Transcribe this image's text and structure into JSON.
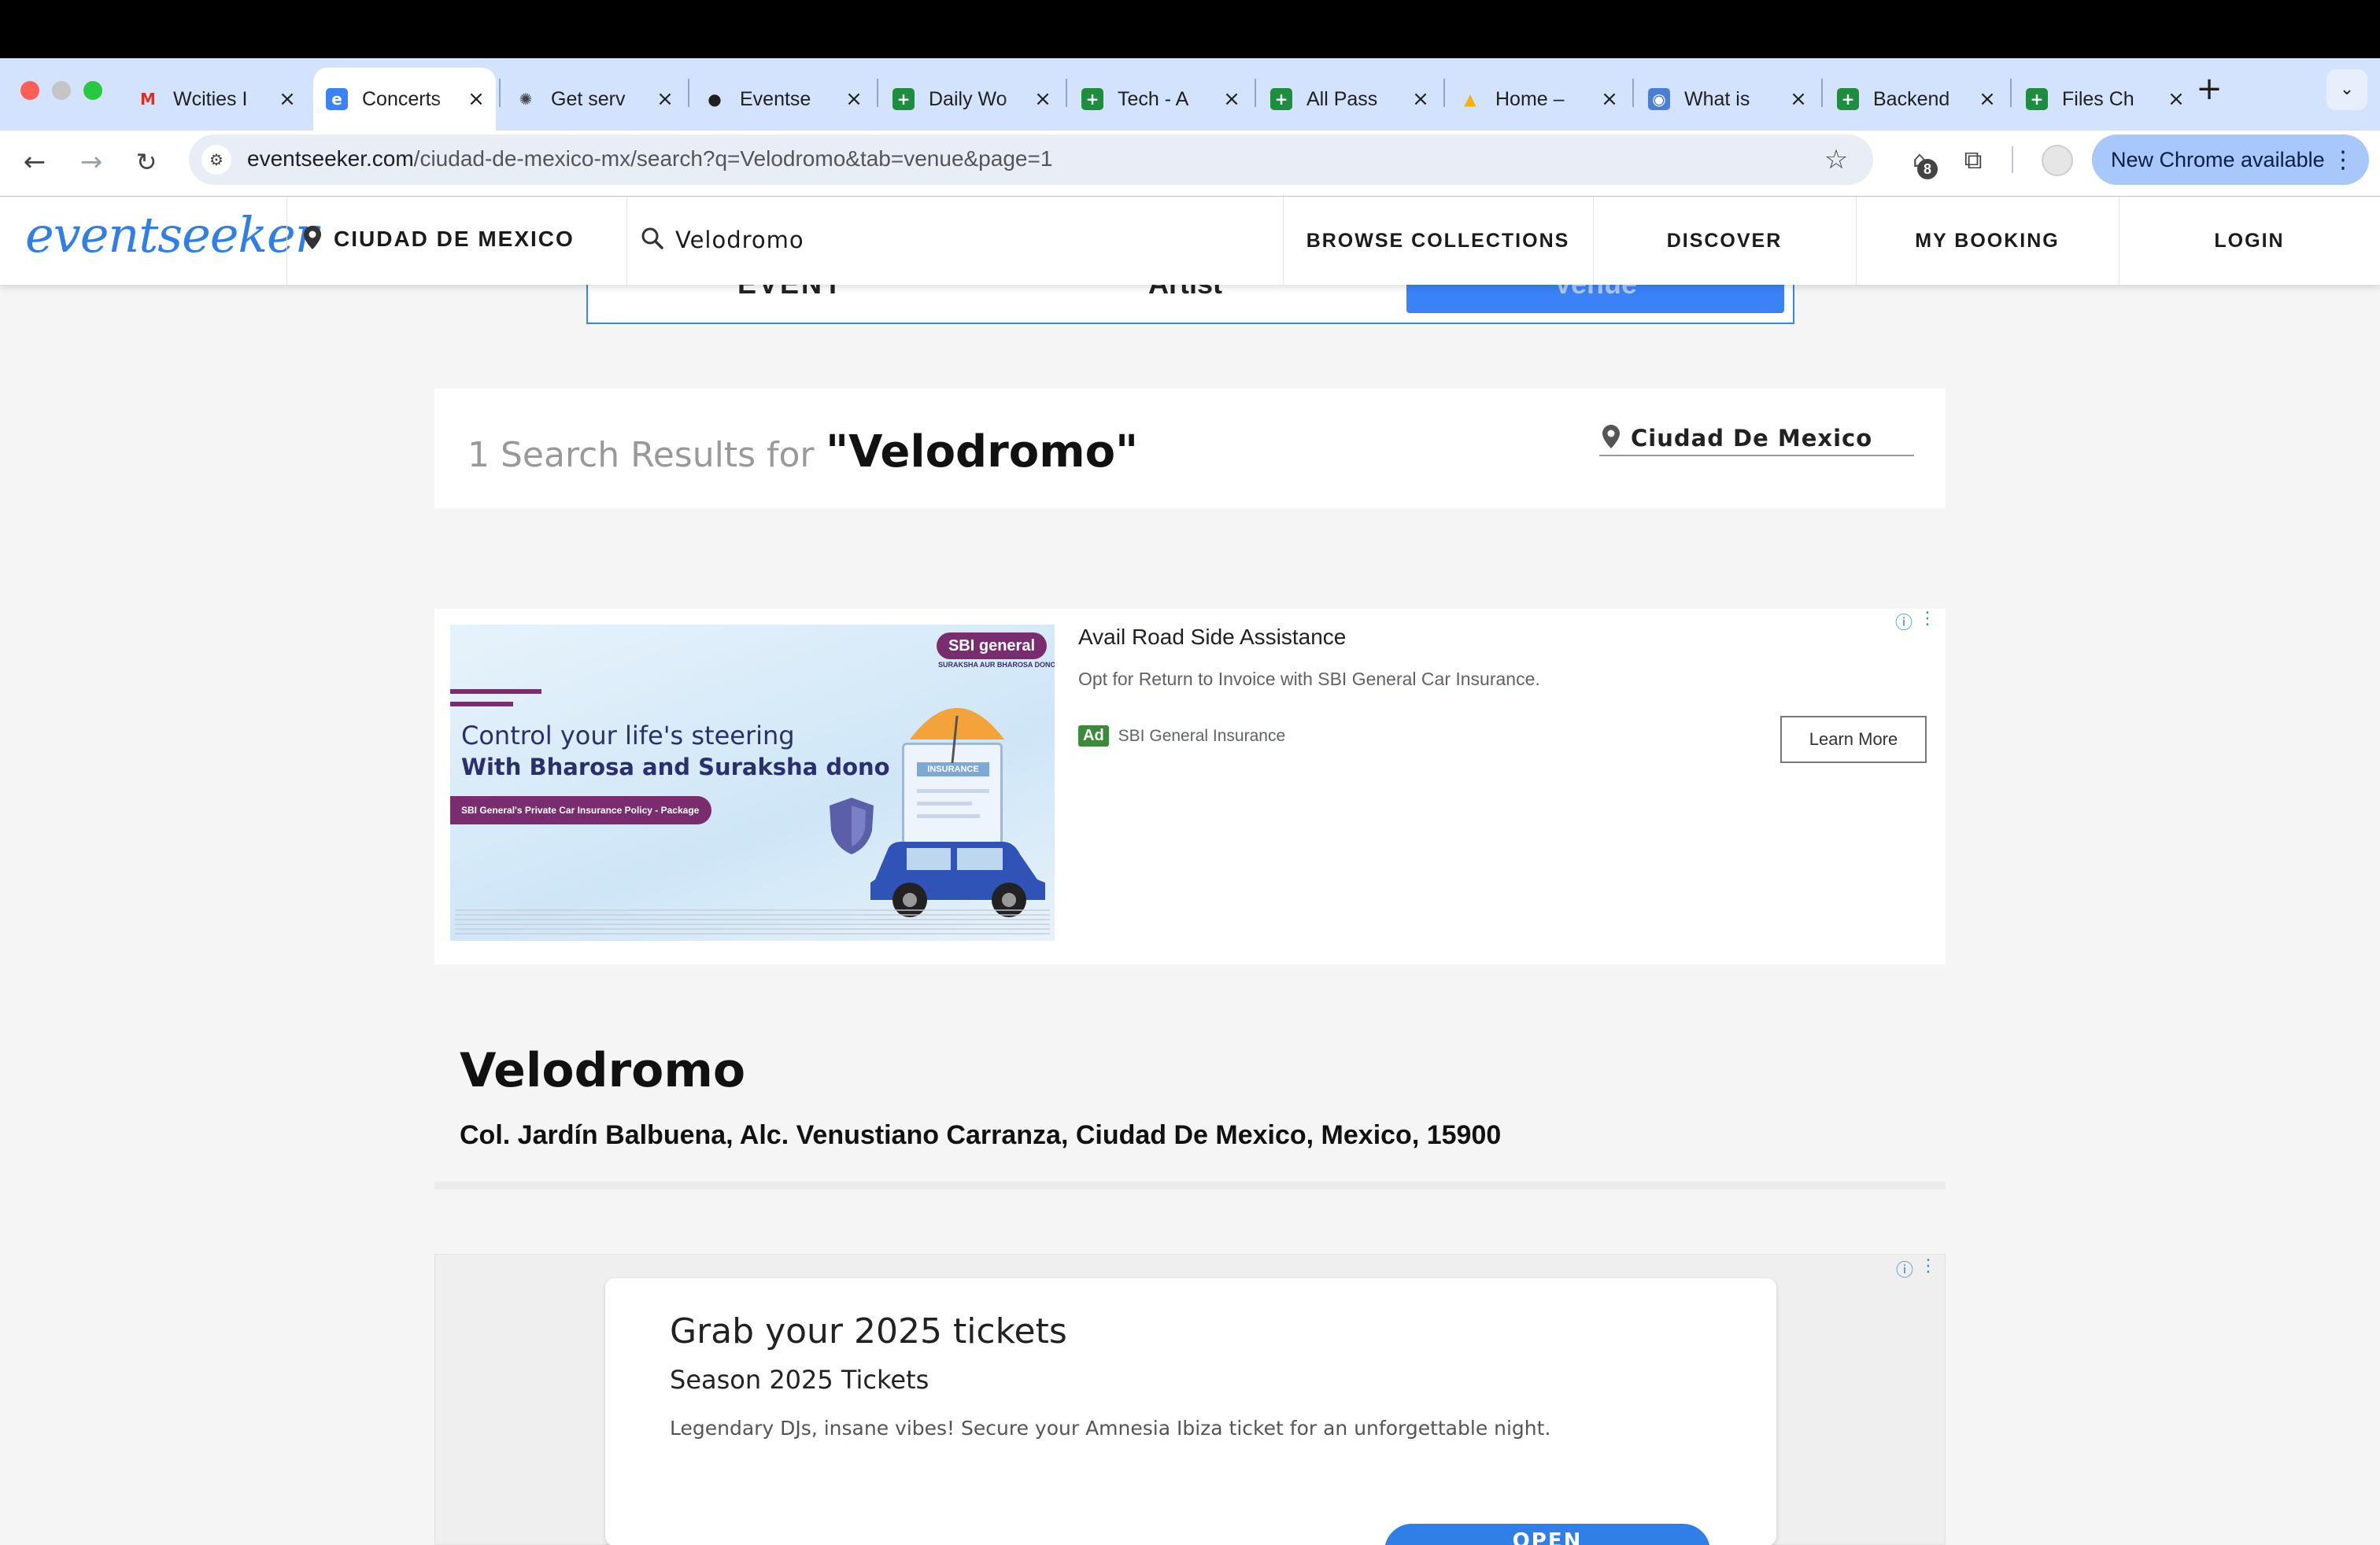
{
  "browser": {
    "tabs": [
      {
        "title": "Wcities I",
        "icon": "gmail-icon"
      },
      {
        "title": "Concerts",
        "icon": "eventseeker-icon"
      },
      {
        "title": "Get serv",
        "icon": "openai-icon"
      },
      {
        "title": "Eventse",
        "icon": "github-icon"
      },
      {
        "title": "Daily Wo",
        "icon": "sheets-icon"
      },
      {
        "title": "Tech - A",
        "icon": "sheets-icon"
      },
      {
        "title": "All Pass",
        "icon": "sheets-icon"
      },
      {
        "title": "Home –",
        "icon": "google-ads-icon"
      },
      {
        "title": "What is",
        "icon": "location-pin-icon"
      },
      {
        "title": "Backend",
        "icon": "sheets-icon"
      },
      {
        "title": "Files Ch",
        "icon": "sheets-icon"
      }
    ],
    "url_domain": "eventseeker.com",
    "url_path": "/ciudad-de-mexico-mx/search?q=Velodromo&tab=venue&page=1",
    "extension_badge": "8",
    "update_button": "New Chrome available"
  },
  "site": {
    "logo": "eventseeker",
    "location": "CIUDAD DE MEXICO",
    "search_value": "Velodromo",
    "nav": [
      "BROWSE COLLECTIONS",
      "DISCOVER",
      "MY BOOKING",
      "LOGIN"
    ],
    "tabs_partial": [
      "EVENT",
      "Artist",
      "Venue"
    ]
  },
  "results": {
    "count_text": "1 Search Results for",
    "query": "\"Velodromo\"",
    "location": "Ciudad De Mexico"
  },
  "ad1": {
    "image_line1": "Control your life's steering",
    "image_line2": "With Bharosa and Suraksha dono",
    "image_tag": "SBI General's Private Car Insurance Policy - Package",
    "brand_logo": "SBI general",
    "brand_tagline": "SURAKSHA AUR BHAROSA DONO",
    "insurance_label": "INSURANCE",
    "title": "Avail Road Side Assistance",
    "description": "Opt for Return to Invoice with SBI General Car Insurance.",
    "badge": "Ad",
    "advertiser": "SBI General Insurance",
    "cta": "Learn More"
  },
  "venue": {
    "name": "Velodromo",
    "address": "Col. Jardín Balbuena, Alc. Venustiano Carranza, Ciudad De Mexico, Mexico, 15900"
  },
  "ad2": {
    "headline": "Grab your 2025 tickets",
    "subheadline": "Season 2025 Tickets",
    "description": "Legendary DJs, insane vibes! Secure your Amnesia Ibiza ticket for an unforgettable night.",
    "cta": "OPEN"
  },
  "colors": {
    "brand_blue": "#2f7fe6",
    "chrome_tabstrip": "#d3e3fd",
    "ad_green": "#3c8b3c"
  }
}
